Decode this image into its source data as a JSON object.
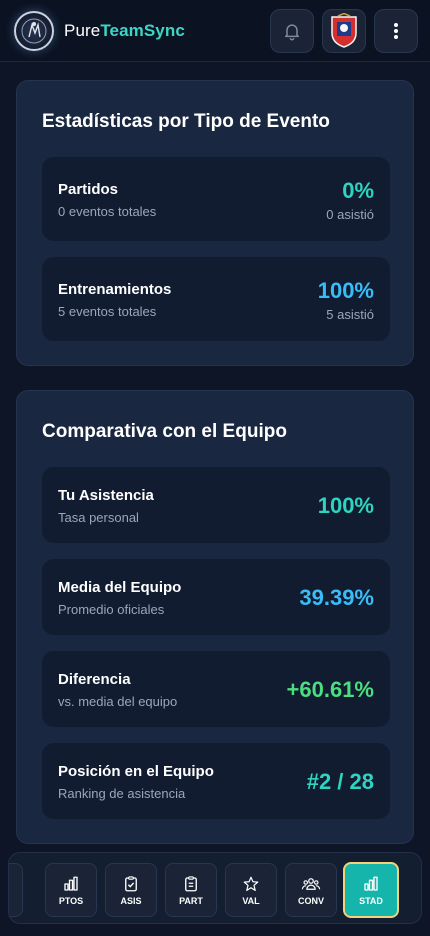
{
  "header": {
    "brand_part1": "Pure",
    "brand_part2": "TeamSync"
  },
  "event_stats": {
    "title": "Estadísticas por Tipo de Evento",
    "items": [
      {
        "name": "Partidos",
        "sub": "0 eventos totales",
        "value": "0%",
        "detail": "0 asistió",
        "color": "#2dd4bf"
      },
      {
        "name": "Entrenamientos",
        "sub": "5 eventos totales",
        "value": "100%",
        "detail": "5 asistió",
        "color": "#38bdf8"
      }
    ]
  },
  "comparison": {
    "title": "Comparativa con el Equipo",
    "items": [
      {
        "name": "Tu Asistencia",
        "sub": "Tasa personal",
        "value": "100%",
        "color": "#2dd4bf"
      },
      {
        "name": "Media del Equipo",
        "sub": "Promedio oficiales",
        "value": "39.39%",
        "color": "#38bdf8"
      },
      {
        "name": "Diferencia",
        "sub": "vs. media del equipo",
        "value": "+60.61%",
        "color": "#4ade80"
      },
      {
        "name": "Posición en el Equipo",
        "sub": "Ranking de asistencia",
        "value": "#2 / 28",
        "color": "#2dd4bf"
      }
    ]
  },
  "bottom_nav": {
    "items": [
      {
        "label": "PTOS",
        "icon": "bar-chart-icon"
      },
      {
        "label": "ASIS",
        "icon": "clipboard-check-icon"
      },
      {
        "label": "PART",
        "icon": "clipboard-list-icon"
      },
      {
        "label": "VAL",
        "icon": "star-icon"
      },
      {
        "label": "CONV",
        "icon": "users-icon"
      },
      {
        "label": "STAD",
        "icon": "bar-chart-icon",
        "active": true
      }
    ]
  }
}
